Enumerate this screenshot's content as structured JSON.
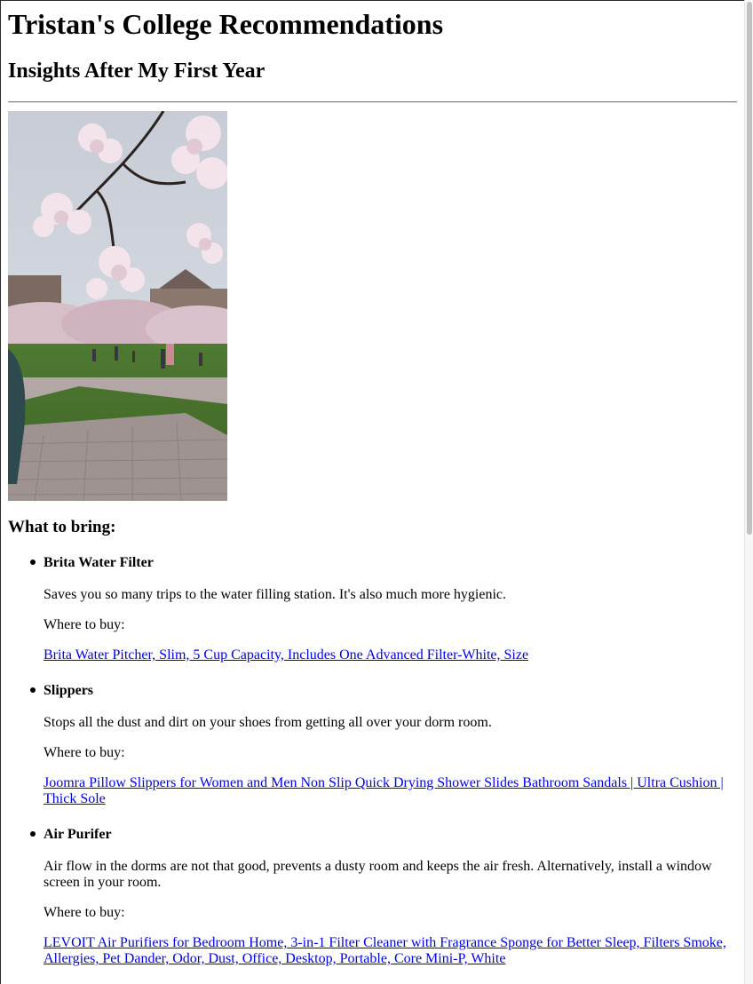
{
  "page": {
    "title": "Tristan's College Recommendations",
    "subtitle": "Insights After My First Year"
  },
  "photo": {
    "description_icon": "cherry-blossom-photo"
  },
  "section": {
    "heading": "What to bring:"
  },
  "items": [
    {
      "title": "Brita Water Filter",
      "description": "Saves you so many trips to the water filling station. It's also much more hygienic.",
      "where_label": "Where to buy:",
      "link_text": "Brita Water Pitcher, Slim, 5 Cup Capacity, Includes One Advanced Filter-White, Size"
    },
    {
      "title": "Slippers",
      "description": "Stops all the dust and dirt on your shoes from getting all over your dorm room.",
      "where_label": "Where to buy:",
      "link_text": "Joomra Pillow Slippers for Women and Men Non Slip Quick Drying Shower Slides Bathroom Sandals | Ultra Cushion | Thick Sole"
    },
    {
      "title": "Air Purifer",
      "description": "Air flow in the dorms are not that good, prevents a dusty room and keeps the air fresh. Alternatively, install a window screen in your room.",
      "where_label": "Where to buy:",
      "link_text": "LEVOIT Air Purifiers for Bedroom Home, 3-in-1 Filter Cleaner with Fragrance Sponge for Better Sleep, Filters Smoke, Allergies, Pet Dander, Odor, Dust, Office, Desktop, Portable, Core Mini-P, White"
    }
  ],
  "colors": {
    "link": "#0000ee",
    "text": "#000000",
    "background": "#ffffff"
  }
}
